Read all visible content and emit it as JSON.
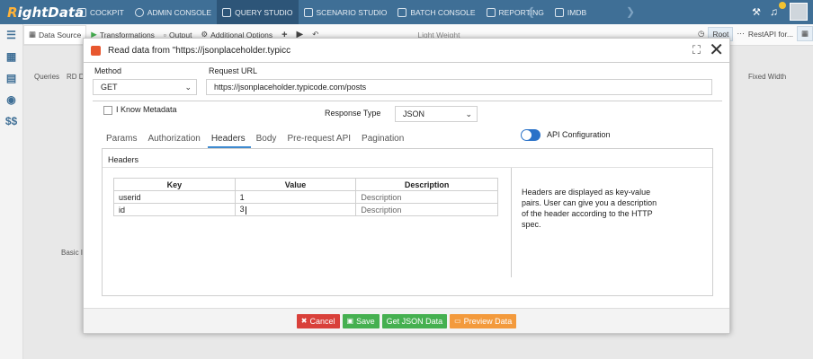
{
  "app": {
    "logo": {
      "first": "R",
      "rest": "ightData"
    },
    "nav": [
      {
        "label": "COCKPIT",
        "icon": "grid-icon"
      },
      {
        "label": "ADMIN CONSOLE",
        "icon": "gear-icon"
      },
      {
        "label": "QUERY STUDIO",
        "icon": "database-icon"
      },
      {
        "label": "SCENARIO STUDIO",
        "icon": "scenario-icon"
      },
      {
        "label": "BATCH CONSOLE",
        "icon": "batch-icon"
      },
      {
        "label": "REPORTING",
        "icon": "report-icon"
      },
      {
        "label": "IMDB",
        "icon": "imdb-icon"
      }
    ]
  },
  "toolbar": {
    "data_source": "Data Source",
    "transformations": "Transformations",
    "output": "Output",
    "additional_options": "Additional Options",
    "light_weight": "Light Weight",
    "root": "Root",
    "restapi": "RestAPI for..."
  },
  "background": {
    "label_queries": "Queries",
    "label_rd": "RD D",
    "label_basic": "Basic I",
    "label_fixed": "Fixed Width"
  },
  "modal": {
    "title": "Read data from \"https://jsonplaceholder.typicc",
    "method_label": "Method",
    "method_value": "GET",
    "url_label": "Request URL",
    "url_value": "https://jsonplaceholder.typicode.com/posts",
    "know_metadata": "I Know Metadata",
    "response_type_label": "Response Type",
    "response_type_value": "JSON",
    "api_config": "API Configuration",
    "tabs": [
      {
        "label": "Params"
      },
      {
        "label": "Authorization"
      },
      {
        "label": "Headers"
      },
      {
        "label": "Body"
      },
      {
        "label": "Pre-request API"
      },
      {
        "label": "Pagination"
      }
    ],
    "headers_title": "Headers",
    "table": {
      "columns": [
        "Key",
        "Value",
        "Description"
      ],
      "rows": [
        {
          "key": "userid",
          "value": "1",
          "description": "Description"
        },
        {
          "key": "id",
          "value": "3",
          "description": "Description"
        }
      ]
    },
    "help_text": "Headers are displayed as key-value pairs. User can give you a description of the header according to the HTTP spec.",
    "buttons": {
      "cancel": "Cancel",
      "save": "Save",
      "get_json": "Get JSON Data",
      "preview": "Preview Data"
    }
  },
  "colors": {
    "nav_bg": "#3f6f96",
    "accent": "#2a72c8",
    "cancel": "#d9403a",
    "save": "#45b050",
    "preview": "#f39a3c"
  }
}
